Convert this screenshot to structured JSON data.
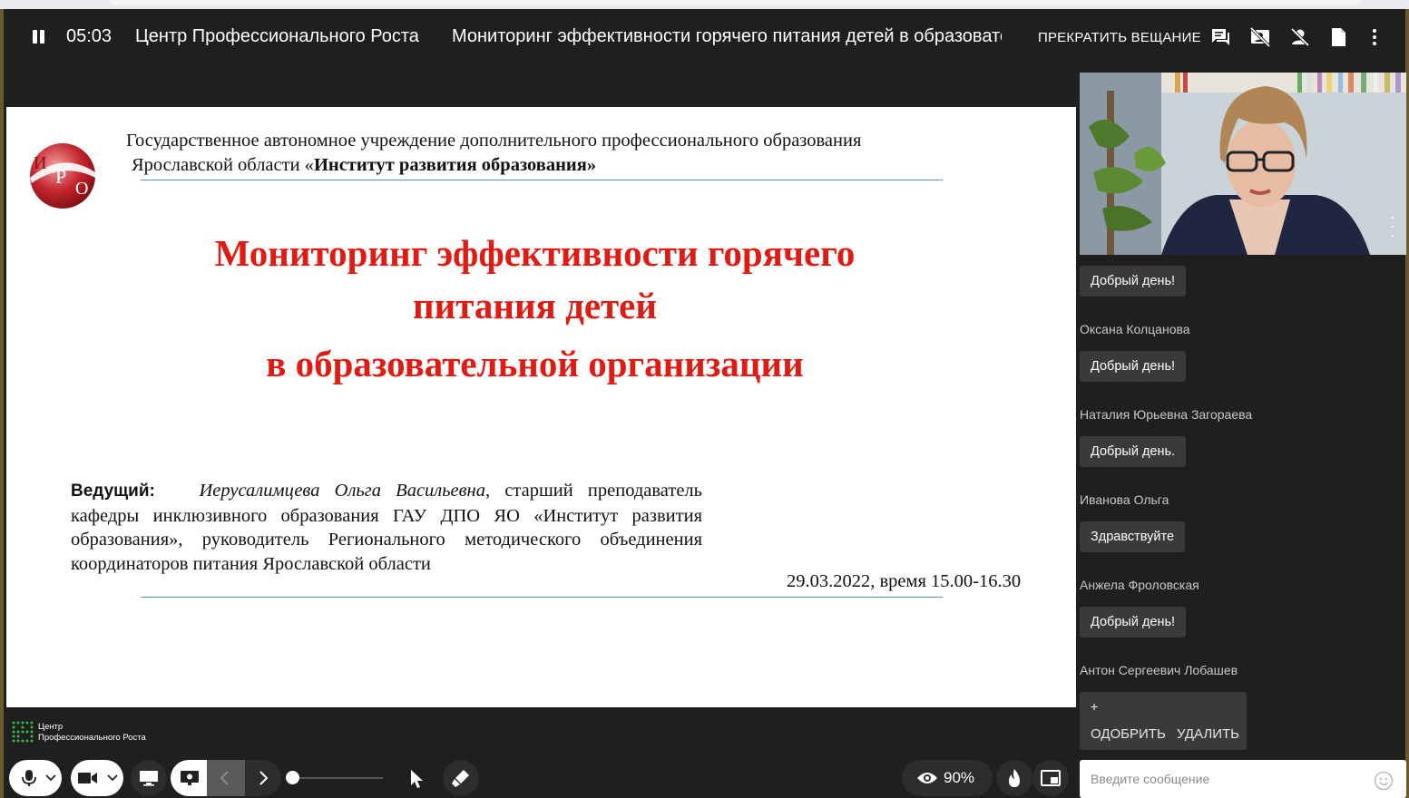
{
  "topbar": {
    "timer": "05:03",
    "org_title": "Центр Профессионального Роста",
    "webinar_title": "Мониторинг эффективности горячего питания детей в образовательной организации",
    "stop_label": "ПРЕКРАТИТЬ ВЕЩАНИЕ"
  },
  "slide": {
    "institution_line1": "Государственное автономное учреждение дополнительного профессионального образования",
    "institution_line2_prefix": "Ярославской области «",
    "institution_line2_bold": "Институт развития образования»",
    "title_line1": "Мониторинг эффективности горячего",
    "title_line2": "питания детей",
    "title_line3": "в образовательной организации",
    "presenter_label": "Ведущий:",
    "presenter_name": "Иерусалимцева Ольга Васильевна",
    "presenter_desc": ", старший преподаватель кафедры инклюзивного образования ГАУ ДПО ЯО «Институт развития образования», руководитель Регионального методического объединения координаторов питания Ярославской области",
    "date": "29.03.2022, время 15.00-16.30",
    "logo_letters": "ИРО"
  },
  "chat": {
    "messages": [
      {
        "text": "Добрый день!"
      },
      {
        "author": "Оксана Колцанова",
        "text": "Добрый день!"
      },
      {
        "author": "Наталия Юрьевна Загораева",
        "text": "Добрый день."
      },
      {
        "author": "Иванова Ольга",
        "text": "Здравствуйте"
      },
      {
        "author": "Анжела Фроловская",
        "text": "Добрый день!"
      },
      {
        "author": "Антон Сергеевич Лобашев"
      }
    ],
    "pending": {
      "text": "+",
      "approve_label": "ОДОБРИТЬ",
      "delete_label": "УДАЛИТЬ"
    },
    "input_placeholder": "Введите сообщение"
  },
  "bottom": {
    "brand_line1": "Центр",
    "brand_line2": "Профессионального Роста",
    "viewers_percent": "90%",
    "volume_level": 0.0
  },
  "colors": {
    "accent_red": "#e01b14",
    "background": "#1f1f20",
    "brand_green": "#39b54a"
  }
}
